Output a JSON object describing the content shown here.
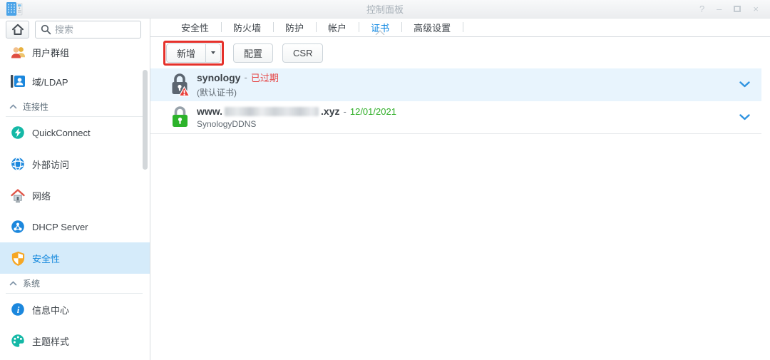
{
  "window": {
    "title": "控制面板"
  },
  "icons": {
    "window_controls": [
      "help-icon",
      "minimize-icon",
      "maximize-icon",
      "close-icon"
    ],
    "help_glyph": "?",
    "minimize_glyph": "–",
    "close_glyph": "×"
  },
  "header": {
    "search_placeholder": "搜索"
  },
  "sidebar": {
    "groups": [
      {
        "header": null,
        "items": [
          {
            "label": "用户群组",
            "icon": "users-icon"
          },
          {
            "label": "域/LDAP",
            "icon": "domain-ldap-icon"
          }
        ]
      },
      {
        "header": "连接性",
        "items": [
          {
            "label": "QuickConnect",
            "icon": "quickconnect-icon"
          },
          {
            "label": "外部访问",
            "icon": "external-access-globe-icon"
          },
          {
            "label": "网络",
            "icon": "network-house-icon"
          },
          {
            "label": "DHCP Server",
            "icon": "dhcp-server-icon"
          },
          {
            "label": "安全性",
            "icon": "security-shield-icon",
            "selected": true
          }
        ]
      },
      {
        "header": "系统",
        "items": [
          {
            "label": "信息中心",
            "icon": "info-center-icon"
          },
          {
            "label": "主题样式",
            "icon": "theme-style-icon"
          }
        ]
      }
    ]
  },
  "tabs": [
    {
      "label": "安全性"
    },
    {
      "label": "防火墙"
    },
    {
      "label": "防护"
    },
    {
      "label": "帐户"
    },
    {
      "label": "证书",
      "selected": true
    },
    {
      "label": "高级设置"
    }
  ],
  "toolbar": {
    "add_label": "新增",
    "configure_label": "配置",
    "csr_label": "CSR",
    "highlight_color": "#e5312b"
  },
  "certificates": {
    "separator": "-",
    "items": [
      {
        "name": "synology",
        "status": "已过期",
        "status_color": "#e64545",
        "subtitle": "(默认证书)",
        "icon": "lock-expired-warning-icon",
        "selected": true
      },
      {
        "name_prefix": "www.",
        "name_redacted": true,
        "name_suffix": ".xyz",
        "status": "12/01/2021",
        "status_color": "#2fae27",
        "subtitle": "SynologyDDNS",
        "icon": "lock-valid-icon"
      }
    ]
  },
  "colors": {
    "accent": "#0c86e2",
    "selected_row_bg": "#e8f4fd",
    "sidebar_selected_bg": "#d5ebfa"
  }
}
